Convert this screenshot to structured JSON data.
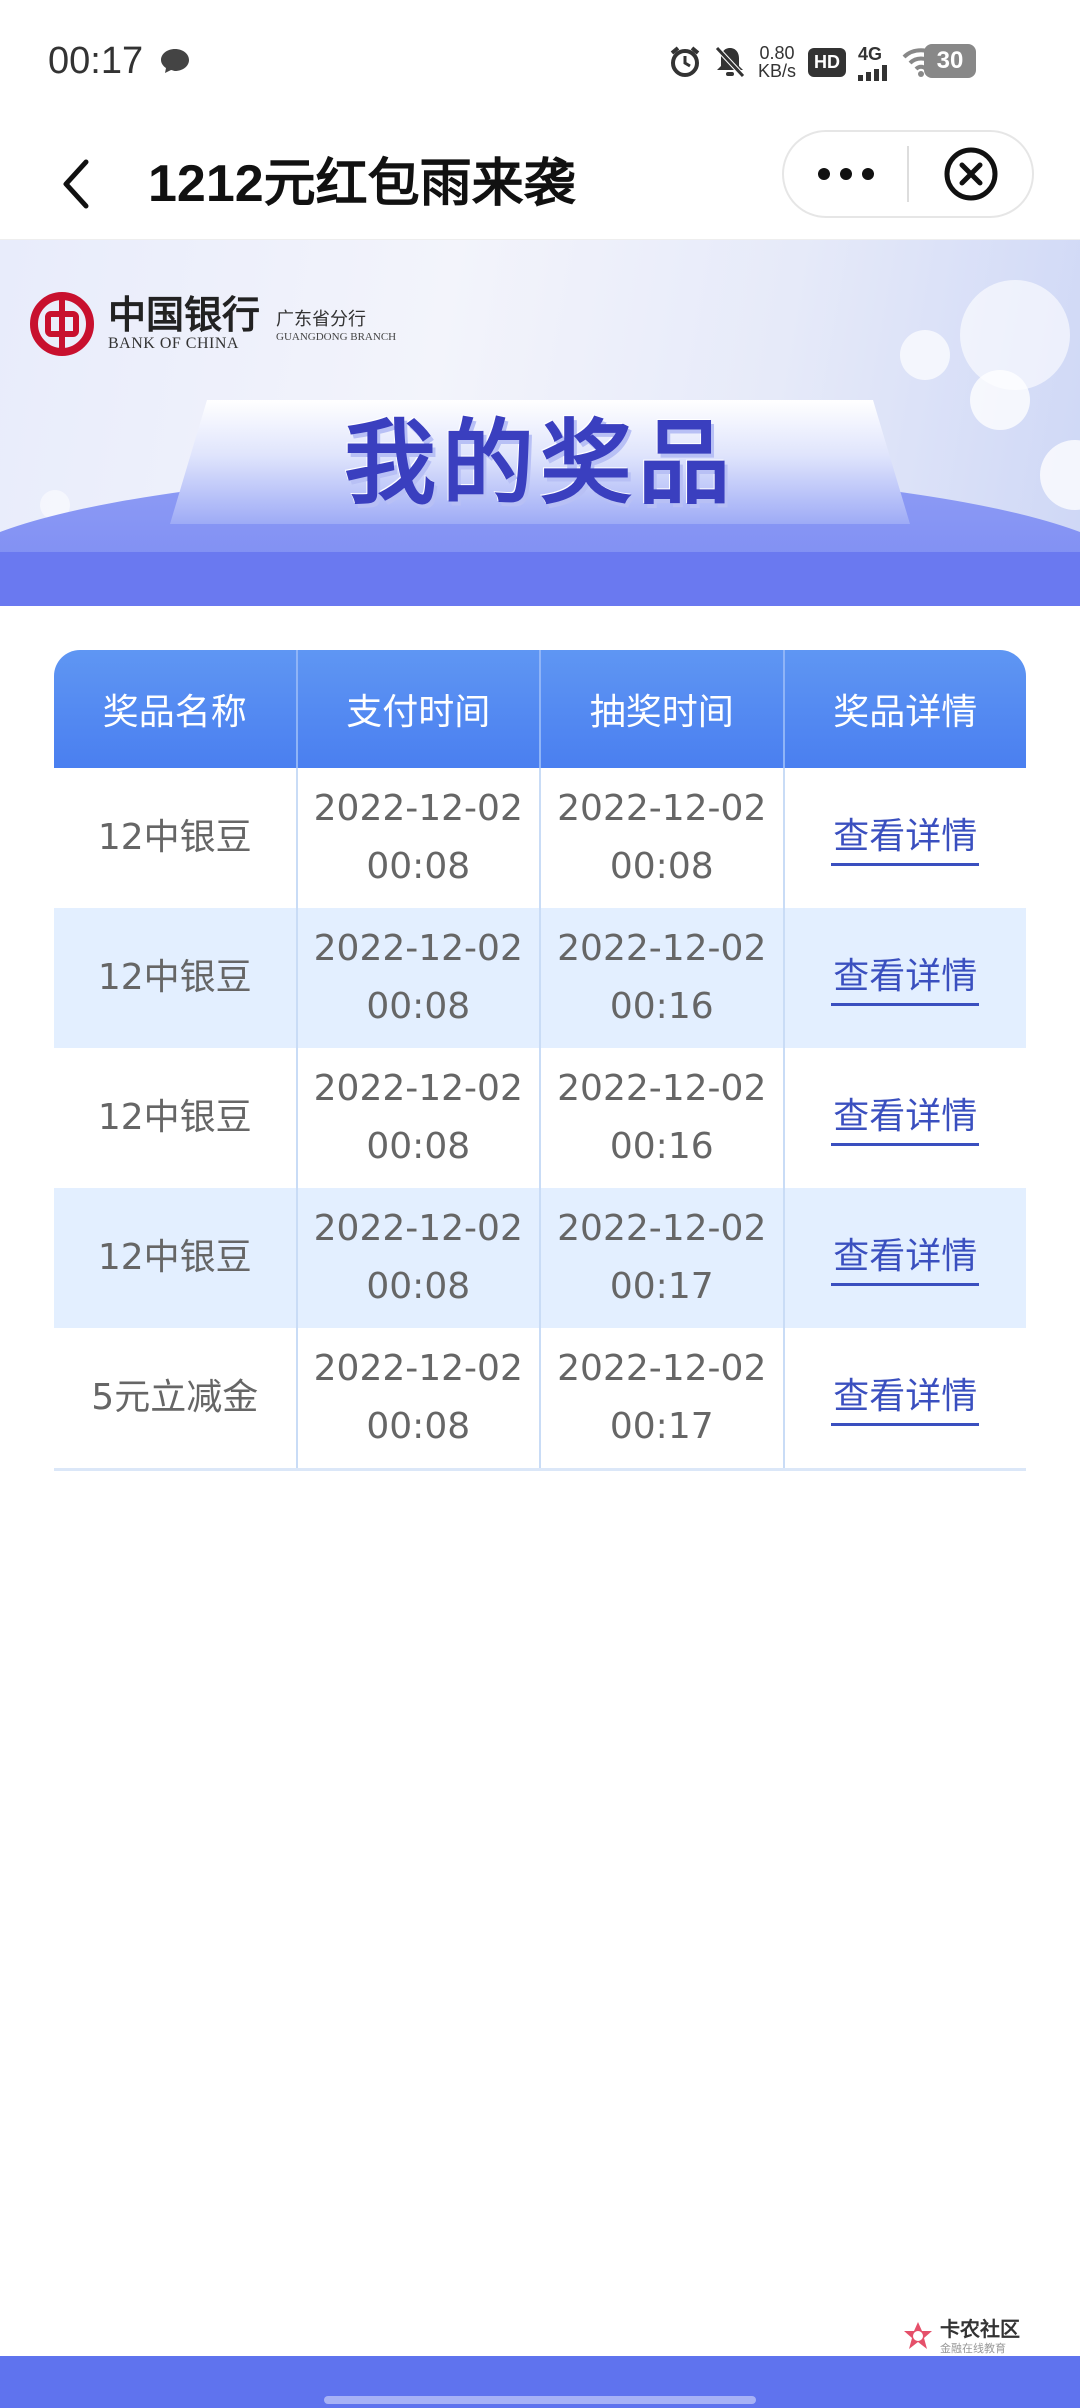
{
  "status_bar": {
    "time": "00:17",
    "net_speed_value": "0.80",
    "net_speed_unit": "KB/s",
    "hd_label": "HD",
    "net_type": "4G",
    "battery": "30"
  },
  "nav": {
    "title": "1212元红包雨来袭"
  },
  "banner": {
    "bank_name_cn": "中国银行",
    "bank_name_en": "BANK OF CHINA",
    "branch_cn": "广东省分行",
    "branch_en": "GUANGDONG BRANCH",
    "title": "我的奖品"
  },
  "table": {
    "headers": [
      "奖品名称",
      "支付时间",
      "抽奖时间",
      "奖品详情"
    ],
    "rows": [
      {
        "name": "12中银豆",
        "pay_date": "2022-12-02",
        "pay_time": "00:08",
        "draw_date": "2022-12-02",
        "draw_time": "00:08",
        "link": "查看详情"
      },
      {
        "name": "12中银豆",
        "pay_date": "2022-12-02",
        "pay_time": "00:08",
        "draw_date": "2022-12-02",
        "draw_time": "00:16",
        "link": "查看详情"
      },
      {
        "name": "12中银豆",
        "pay_date": "2022-12-02",
        "pay_time": "00:08",
        "draw_date": "2022-12-02",
        "draw_time": "00:16",
        "link": "查看详情"
      },
      {
        "name": "12中银豆",
        "pay_date": "2022-12-02",
        "pay_time": "00:08",
        "draw_date": "2022-12-02",
        "draw_time": "00:17",
        "link": "查看详情"
      },
      {
        "name": "5元立减金",
        "pay_date": "2022-12-02",
        "pay_time": "00:08",
        "draw_date": "2022-12-02",
        "draw_time": "00:17",
        "link": "查看详情"
      }
    ]
  },
  "watermark": {
    "title": "卡农社区",
    "subtitle": "金融在线教育"
  },
  "colors": {
    "header_blue": "#4a7ff0",
    "row_alt": "#e3efff",
    "link": "#3a4fbf",
    "bottom_bar": "#5f73ee"
  },
  "icons": [
    "chat-icon",
    "alarm-icon",
    "mute-icon",
    "wifi-icon",
    "signal-icon",
    "back-arrow-icon",
    "more-icon",
    "close-circle-icon"
  ]
}
